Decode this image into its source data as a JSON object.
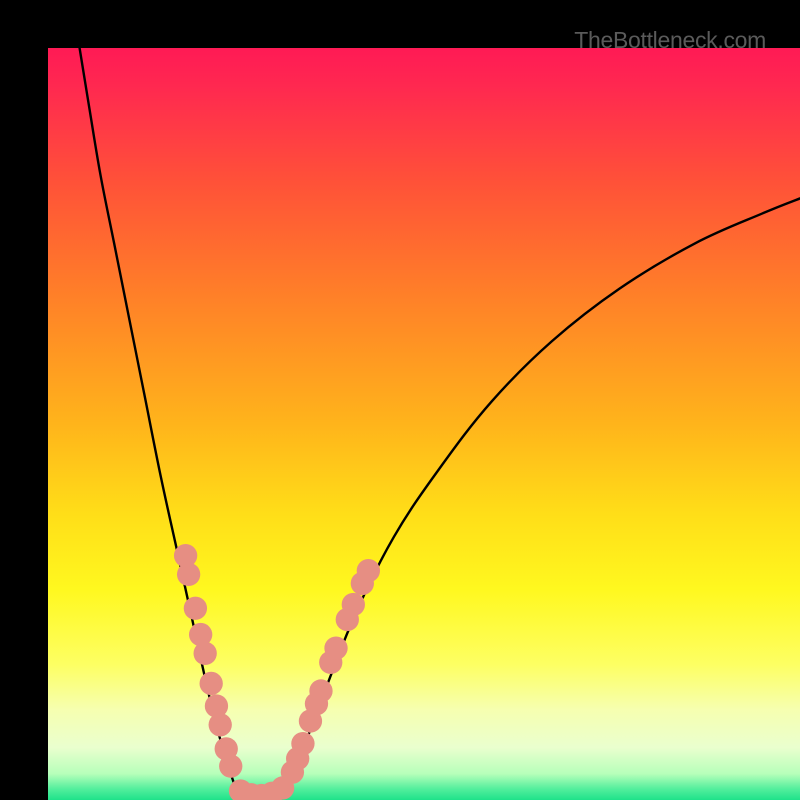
{
  "watermark": "TheBottleneck.com",
  "chart_data": {
    "type": "line",
    "title": "",
    "xlabel": "",
    "ylabel": "",
    "xlim": [
      0,
      100
    ],
    "ylim": [
      0,
      100
    ],
    "background_gradient_stops": [
      {
        "offset": 0,
        "color": "#ff1a55"
      },
      {
        "offset": 0.05,
        "color": "#ff2850"
      },
      {
        "offset": 0.18,
        "color": "#ff5238"
      },
      {
        "offset": 0.33,
        "color": "#ff8028"
      },
      {
        "offset": 0.5,
        "color": "#ffb41b"
      },
      {
        "offset": 0.62,
        "color": "#ffde18"
      },
      {
        "offset": 0.72,
        "color": "#fff81f"
      },
      {
        "offset": 0.82,
        "color": "#fdff63"
      },
      {
        "offset": 0.88,
        "color": "#f6ffb0"
      },
      {
        "offset": 0.93,
        "color": "#eaffce"
      },
      {
        "offset": 0.965,
        "color": "#b7ffba"
      },
      {
        "offset": 0.985,
        "color": "#54ef9d"
      },
      {
        "offset": 1.0,
        "color": "#1fe28a"
      }
    ],
    "series": [
      {
        "name": "left-branch",
        "x": [
          4.2,
          5.5,
          7.0,
          8.8,
          10.8,
          12.8,
          15.0,
          17.2,
          19.4,
          21.4,
          23.2,
          24.8
        ],
        "y": [
          100,
          92,
          83,
          74,
          64,
          54,
          43,
          33,
          23,
          14,
          7,
          2
        ]
      },
      {
        "name": "valley-floor",
        "x": [
          24.8,
          25.5,
          26.4,
          27.3,
          28.2,
          29.1,
          30.0,
          31.0,
          32.0
        ],
        "y": [
          2,
          1.2,
          0.8,
          0.6,
          0.5,
          0.6,
          0.9,
          1.4,
          2.2
        ]
      },
      {
        "name": "right-branch",
        "x": [
          32.0,
          34.0,
          37.0,
          41.0,
          46.0,
          52.0,
          59.0,
          67.0,
          76.0,
          86.0,
          95.0,
          100.0
        ],
        "y": [
          2.2,
          7,
          15,
          25,
          35,
          44,
          53,
          61,
          68,
          74,
          78,
          80
        ]
      }
    ],
    "markers": [
      {
        "series": "left-beads",
        "x": 18.7,
        "y": 30.0,
        "r": 1.55
      },
      {
        "series": "left-beads",
        "x": 18.3,
        "y": 32.5,
        "r": 1.55
      },
      {
        "series": "left-beads",
        "x": 19.6,
        "y": 25.5,
        "r": 1.55
      },
      {
        "series": "left-beads",
        "x": 20.3,
        "y": 22.0,
        "r": 1.55
      },
      {
        "series": "left-beads",
        "x": 20.9,
        "y": 19.5,
        "r": 1.55
      },
      {
        "series": "left-beads",
        "x": 21.7,
        "y": 15.5,
        "r": 1.55
      },
      {
        "series": "left-beads",
        "x": 22.4,
        "y": 12.5,
        "r": 1.55
      },
      {
        "series": "left-beads",
        "x": 22.9,
        "y": 10.0,
        "r": 1.55
      },
      {
        "series": "left-beads",
        "x": 23.7,
        "y": 6.8,
        "r": 1.55
      },
      {
        "series": "left-beads",
        "x": 24.3,
        "y": 4.5,
        "r": 1.55
      },
      {
        "series": "floor-beads",
        "x": 25.6,
        "y": 1.2,
        "r": 1.55
      },
      {
        "series": "floor-beads",
        "x": 27.0,
        "y": 0.7,
        "r": 1.55
      },
      {
        "series": "floor-beads",
        "x": 28.4,
        "y": 0.6,
        "r": 1.55
      },
      {
        "series": "floor-beads",
        "x": 29.8,
        "y": 0.9,
        "r": 1.55
      },
      {
        "series": "floor-beads",
        "x": 31.2,
        "y": 1.6,
        "r": 1.55
      },
      {
        "series": "right-beads",
        "x": 32.5,
        "y": 3.7,
        "r": 1.55
      },
      {
        "series": "right-beads",
        "x": 33.2,
        "y": 5.5,
        "r": 1.55
      },
      {
        "series": "right-beads",
        "x": 33.9,
        "y": 7.5,
        "r": 1.55
      },
      {
        "series": "right-beads",
        "x": 34.9,
        "y": 10.5,
        "r": 1.55
      },
      {
        "series": "right-beads",
        "x": 35.7,
        "y": 12.8,
        "r": 1.55
      },
      {
        "series": "right-beads",
        "x": 36.3,
        "y": 14.5,
        "r": 1.55
      },
      {
        "series": "right-beads",
        "x": 37.6,
        "y": 18.3,
        "r": 1.55
      },
      {
        "series": "right-beads",
        "x": 38.3,
        "y": 20.2,
        "r": 1.55
      },
      {
        "series": "right-beads",
        "x": 39.8,
        "y": 24.0,
        "r": 1.55
      },
      {
        "series": "right-beads",
        "x": 40.6,
        "y": 26.0,
        "r": 1.55
      },
      {
        "series": "right-beads",
        "x": 41.8,
        "y": 28.8,
        "r": 1.55
      },
      {
        "series": "right-beads",
        "x": 42.6,
        "y": 30.5,
        "r": 1.55
      }
    ],
    "marker_color": "#e68e83",
    "curve_color": "#000000"
  }
}
